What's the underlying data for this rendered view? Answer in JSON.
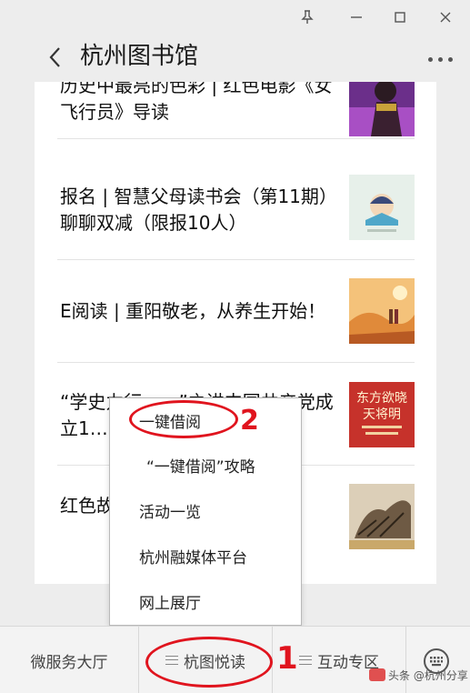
{
  "window": {
    "icons": {
      "pin": "pin-icon",
      "minimize": "minimize-icon",
      "maximize": "maximize-icon",
      "close": "close-icon"
    }
  },
  "header": {
    "title": "杭州图书馆",
    "back_icon": "chevron-left-icon",
    "more_icon": "more-icon"
  },
  "articles": [
    {
      "title": "历史中最亮的色彩 | 红色电影《女飞行员》导读",
      "thumb": "film-poster-thumbnail"
    },
    {
      "title": "报名 | 智慧父母读书会（第11期）聊聊双减（限报10人）",
      "thumb": "reading-club-thumbnail"
    },
    {
      "title": "E阅读 | 重阳敬老，从养生开始！",
      "thumb": "autumn-scene-thumbnail"
    },
    {
      "title": "“学史力行……”之讲中国共产党成立1……敬……",
      "thumb": "book-cover-thumbnail",
      "thumb_text": "东方欲晓天将明"
    },
    {
      "title": "红色故……天 | 今日推荐……",
      "thumb": "woodcut-thumbnail"
    }
  ],
  "popup_menu": {
    "items": [
      "一键借阅",
      "“一键借阅”攻略",
      "活动一览",
      "杭州融媒体平台",
      "网上展厅"
    ]
  },
  "bottom_menu": {
    "tabs": [
      "微服务大厅",
      "杭图悦读",
      "互动专区"
    ],
    "keyboard_icon": "keyboard-icon"
  },
  "annotations": {
    "label_1": "1",
    "label_2": "2"
  },
  "watermark": "头条 @杭州分享",
  "colors": {
    "annotation": "#e0141e",
    "background": "#ededed"
  }
}
